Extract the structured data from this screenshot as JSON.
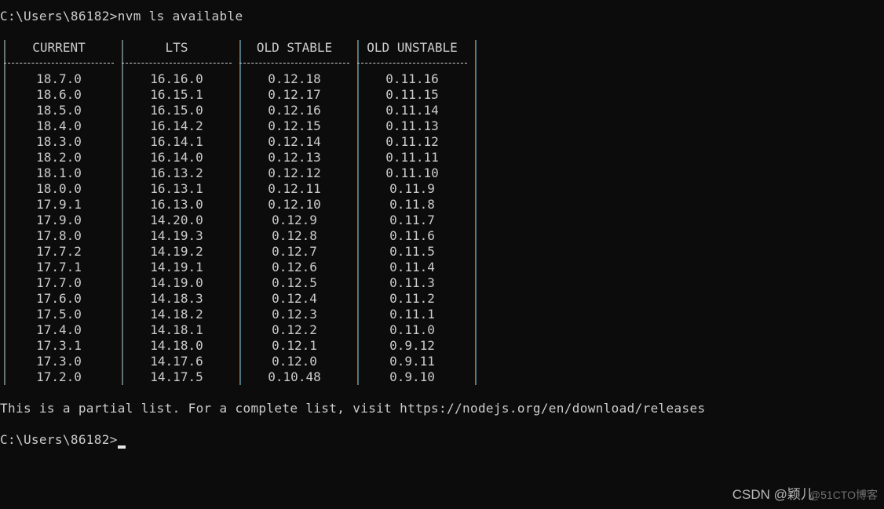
{
  "terminal": {
    "prompt": "C:\\Users\\86182>",
    "command": "nvm ls available",
    "note": "This is a partial list. For a complete list, visit https://nodejs.org/en/download/releases",
    "cursor": "cursor-block"
  },
  "table": {
    "columns": [
      {
        "header": "CURRENT",
        "values": [
          "18.7.0",
          "18.6.0",
          "18.5.0",
          "18.4.0",
          "18.3.0",
          "18.2.0",
          "18.1.0",
          "18.0.0",
          "17.9.1",
          "17.9.0",
          "17.8.0",
          "17.7.2",
          "17.7.1",
          "17.7.0",
          "17.6.0",
          "17.5.0",
          "17.4.0",
          "17.3.1",
          "17.3.0",
          "17.2.0"
        ]
      },
      {
        "header": "LTS",
        "values": [
          "16.16.0",
          "16.15.1",
          "16.15.0",
          "16.14.2",
          "16.14.1",
          "16.14.0",
          "16.13.2",
          "16.13.1",
          "16.13.0",
          "14.20.0",
          "14.19.3",
          "14.19.2",
          "14.19.1",
          "14.19.0",
          "14.18.3",
          "14.18.2",
          "14.18.1",
          "14.18.0",
          "14.17.6",
          "14.17.5"
        ]
      },
      {
        "header": "OLD STABLE",
        "values": [
          "0.12.18",
          "0.12.17",
          "0.12.16",
          "0.12.15",
          "0.12.14",
          "0.12.13",
          "0.12.12",
          "0.12.11",
          "0.12.10",
          "0.12.9",
          "0.12.8",
          "0.12.7",
          "0.12.6",
          "0.12.5",
          "0.12.4",
          "0.12.3",
          "0.12.2",
          "0.12.1",
          "0.12.0",
          "0.10.48"
        ]
      },
      {
        "header": "OLD UNSTABLE",
        "values": [
          "0.11.16",
          "0.11.15",
          "0.11.14",
          "0.11.13",
          "0.11.12",
          "0.11.11",
          "0.11.10",
          "0.11.9",
          "0.11.8",
          "0.11.7",
          "0.11.6",
          "0.11.5",
          "0.11.4",
          "0.11.3",
          "0.11.2",
          "0.11.1",
          "0.11.0",
          "0.9.12",
          "0.9.11",
          "0.9.10"
        ]
      }
    ]
  },
  "watermark": {
    "text": "CSDN @颖儿",
    "overlay": "@51CTO博客"
  }
}
